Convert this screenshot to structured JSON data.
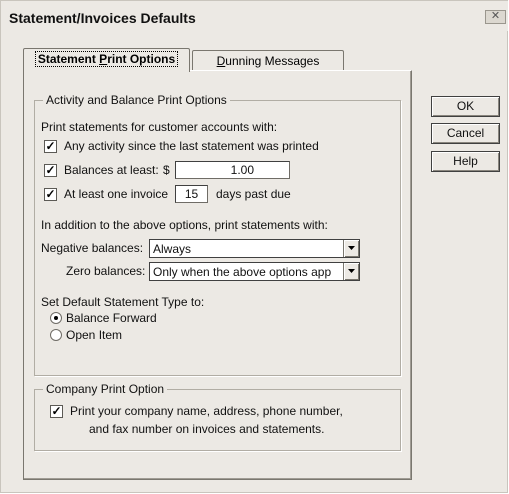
{
  "window": {
    "title": "Statement/Invoices Defaults",
    "close_symbol": "✕"
  },
  "tabs": [
    {
      "label_pre": "Statement ",
      "label_ul": "P",
      "label_post": "rint Options",
      "active": true
    },
    {
      "label_pre": "",
      "label_ul": "D",
      "label_post": "unning Messages",
      "active": false
    }
  ],
  "activity_group": {
    "title": "Activity and Balance Print Options",
    "intro": "Print statements for customer accounts with:",
    "any_activity": {
      "label": "Any activity since the last statement was printed",
      "checked": true
    },
    "balances_at_least": {
      "label": "Balances at least:",
      "currency": "$",
      "value": "1.00",
      "checked": true
    },
    "invoice_past_due": {
      "label": "At least one invoice",
      "days": "15",
      "suffix": "days past due",
      "checked": true
    },
    "addition_text": "In addition to the above options, print statements with:",
    "negative_balances": {
      "label": "Negative balances:",
      "value": "Always"
    },
    "zero_balances": {
      "label": "Zero balances:",
      "value": "Only when the above options app"
    },
    "statement_type_title": "Set Default Statement Type to:",
    "statement_types": [
      {
        "label": "Balance Forward",
        "selected": true
      },
      {
        "label": "Open Item",
        "selected": false
      }
    ]
  },
  "company_group": {
    "title": "Company Print Option",
    "checked": true,
    "line1": "Print your company name, address, phone number,",
    "line2": "and fax number on invoices and statements."
  },
  "buttons": {
    "ok": "OK",
    "cancel": "Cancel",
    "help": "Help"
  },
  "check_mark": "✓",
  "icons": {
    "close": "close-icon",
    "dropdown": "chevron-down-icon"
  }
}
